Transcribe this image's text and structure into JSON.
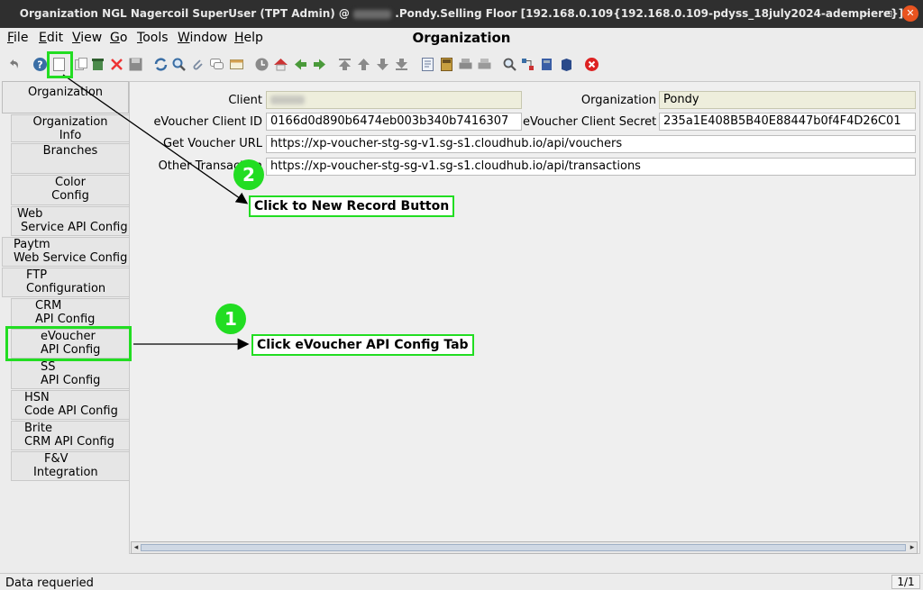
{
  "window": {
    "title_prefix": "Organization  NGL  Nagercoil  SuperUser (TPT Admin) @",
    "title_suffix": ".Pondy.Selling Floor [192.168.0.109{192.168.0.109-pdyss_18july2024-adempiere}]",
    "minimize_glyph": "–",
    "maximize_glyph": "▫",
    "close_glyph": "✕"
  },
  "menu": {
    "file": "File",
    "edit": "Edit",
    "view": "View",
    "go": "Go",
    "tools": "Tools",
    "window": "Window",
    "help": "Help",
    "heading": "Organization"
  },
  "tabs": [
    {
      "line1": "Organization",
      "line2": ""
    },
    {
      "line1": "Organization",
      "line2": "Info"
    },
    {
      "line1": "Branches",
      "line2": ""
    },
    {
      "line1": "Color",
      "line2": "Config"
    },
    {
      "line1": "Web",
      "line2": "Service API Config"
    },
    {
      "line1": "Paytm",
      "line2": "Web Service Config"
    },
    {
      "line1": "FTP",
      "line2": "Configuration"
    },
    {
      "line1": "CRM",
      "line2": "API Config"
    },
    {
      "line1": "eVoucher",
      "line2": "API Config"
    },
    {
      "line1": "SS",
      "line2": "API Config"
    },
    {
      "line1": "HSN",
      "line2": "Code API Config"
    },
    {
      "line1": "Brite",
      "line2": "CRM API Config"
    },
    {
      "line1": "F&V",
      "line2": "Integration"
    }
  ],
  "form": {
    "client_label": "Client",
    "organization_label": "Organization",
    "organization_value": "Pondy",
    "client_id_label": "eVoucher Client ID",
    "client_id_value": "0166d0d890b6474eb003b340b7416307",
    "client_secret_label": "eVoucher Client Secret",
    "client_secret_value": "235a1E408B5B40E88447b0f4F4D26C01",
    "get_voucher_label": "Get Voucher URL",
    "get_voucher_value": "https://xp-voucher-stg-sg-v1.sg-s1.cloudhub.io/api/vouchers",
    "other_transaction_label": "Other Transaction",
    "other_transaction_value": "https://xp-voucher-stg-sg-v1.sg-s1.cloudhub.io/api/transactions"
  },
  "status": {
    "message": "Data requeried",
    "record_count": "1/1"
  },
  "annotations": {
    "step1_number": "1",
    "step1_text": "Click eVoucher API Config Tab",
    "step2_number": "2",
    "step2_text": "Click to New Record Button",
    "accent_color": "#22dd22"
  },
  "toolbar_icons": [
    "undo-icon",
    "help-icon",
    "new-record-icon",
    "copy-record-icon",
    "delete-icon",
    "delete-selection-icon",
    "save-icon",
    "refresh-icon",
    "find-icon",
    "attachment-icon",
    "chat-icon",
    "multi-view-icon",
    "history-icon",
    "home-icon",
    "back-icon",
    "forward-icon",
    "first-record-icon",
    "previous-record-icon",
    "next-record-icon",
    "last-record-icon",
    "report-icon",
    "archive-icon",
    "print-icon",
    "print-preview-icon",
    "zoom-across-icon",
    "active-workflows-icon",
    "requests-icon",
    "product-info-icon",
    "exit-icon"
  ]
}
